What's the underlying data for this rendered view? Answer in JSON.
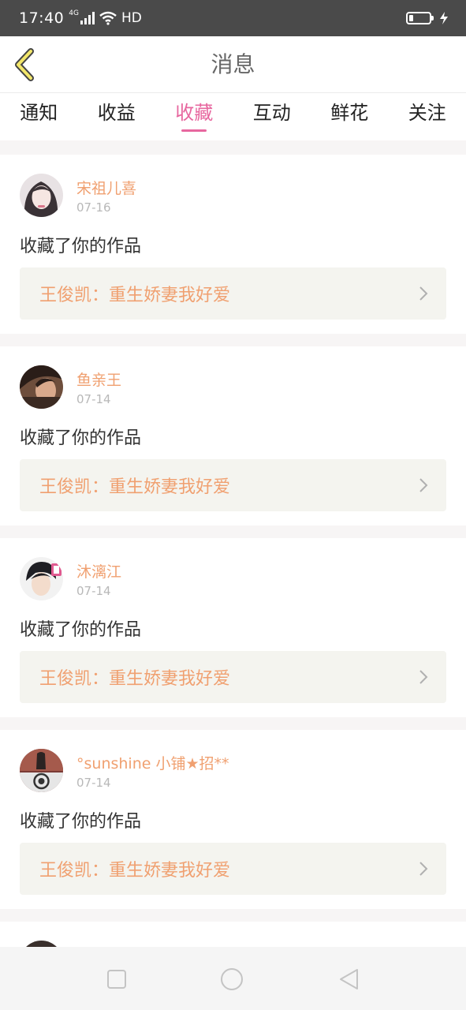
{
  "status_bar": {
    "time": "17:40",
    "network": "4G",
    "hd": "HD",
    "battery_level_percent": 20,
    "charging": true
  },
  "header": {
    "title": "消息",
    "back_icon": "chevron-left-icon"
  },
  "tabs": [
    {
      "label": "通知",
      "active": false
    },
    {
      "label": "收益",
      "active": false
    },
    {
      "label": "收藏",
      "active": true
    },
    {
      "label": "互动",
      "active": false
    },
    {
      "label": "鲜花",
      "active": false
    },
    {
      "label": "关注",
      "active": false
    }
  ],
  "messages": [
    {
      "user": "宋祖儿喜",
      "date": "07-16",
      "action": "收藏了你的作品",
      "work": "王俊凯：重生娇妻我好爱"
    },
    {
      "user": "鱼亲王",
      "date": "07-14",
      "action": "收藏了你的作品",
      "work": "王俊凯：重生娇妻我好爱"
    },
    {
      "user": "沐漓江",
      "date": "07-14",
      "action": "收藏了你的作品",
      "work": "王俊凯：重生娇妻我好爱"
    },
    {
      "user": "°sunshine 小铺★招**",
      "date": "07-14",
      "action": "收藏了你的作品",
      "work": "王俊凯：重生娇妻我好爱"
    }
  ],
  "colors": {
    "accent": "#e7679f",
    "name_orange": "#f0a070",
    "link_bg": "#f4f4ef"
  },
  "nav_bar": {
    "icons": [
      "square-icon",
      "circle-icon",
      "triangle-back-icon"
    ]
  }
}
